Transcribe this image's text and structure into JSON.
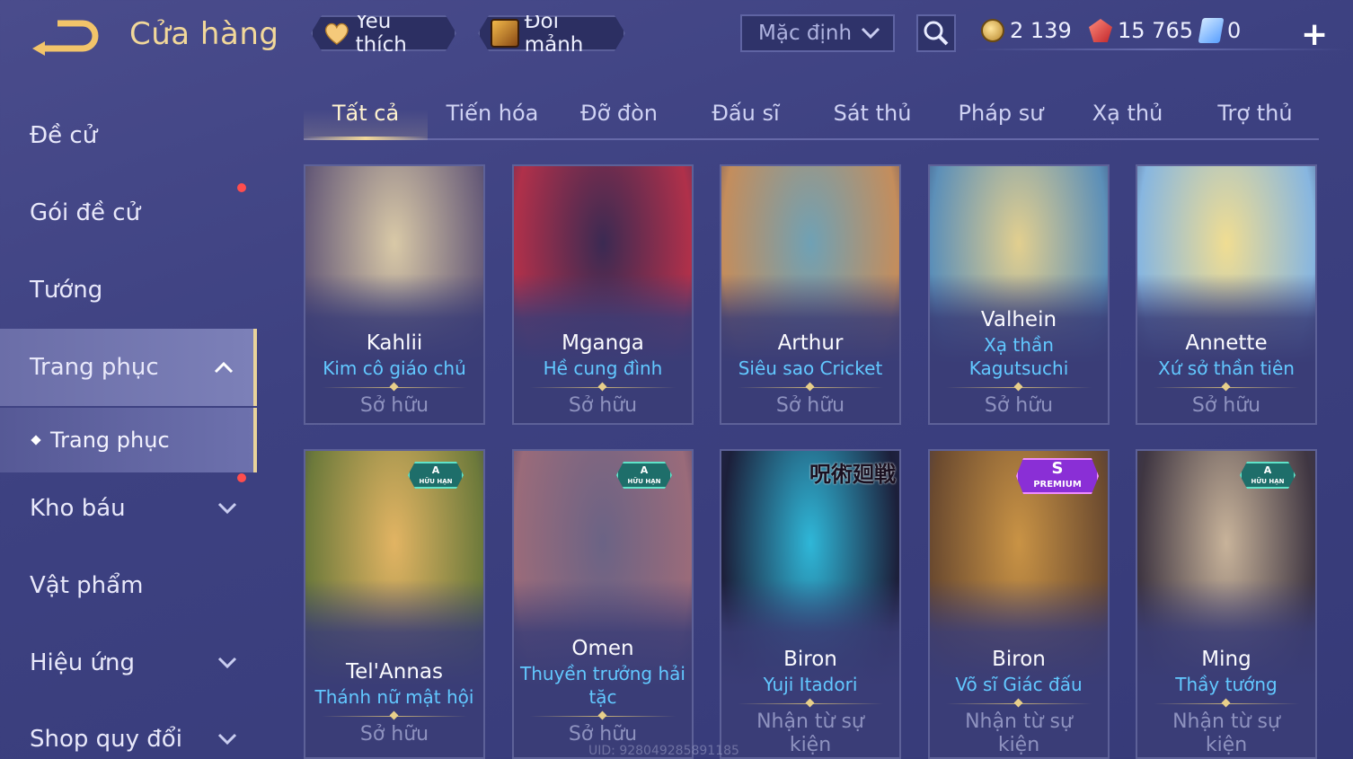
{
  "header": {
    "title": "Cửa hàng",
    "favorites_label": "Yêu thích",
    "exchange_label": "Đổi mảnh",
    "sort_value": "Mặc định",
    "currencies": [
      {
        "icon": "gold-coin-icon",
        "value": "2 139"
      },
      {
        "icon": "ruby-icon",
        "value": "15 765"
      },
      {
        "icon": "voucher-icon",
        "value": "0"
      }
    ]
  },
  "sidebar": {
    "items": [
      {
        "label": "Đề cử"
      },
      {
        "label": "Gói đề cử"
      },
      {
        "label": "Tướng"
      },
      {
        "label": "Trang phục"
      },
      {
        "label": "Kho báu"
      },
      {
        "label": "Vật phẩm"
      },
      {
        "label": "Hiệu ứng"
      },
      {
        "label": "Shop quy đổi"
      }
    ],
    "sub_item": "Trang phục"
  },
  "tabs": [
    "Tất cả",
    "Tiến hóa",
    "Đỡ đòn",
    "Đấu sĩ",
    "Sát thủ",
    "Pháp sư",
    "Xạ thủ",
    "Trợ thủ"
  ],
  "cards": [
    {
      "hero": "Kahlii",
      "skin": "Kim cô giáo chủ",
      "status": "Sở hữu",
      "badge": "",
      "colors": [
        "#d9c9a7",
        "#6b5f7a"
      ]
    },
    {
      "hero": "Mganga",
      "skin": "Hề cung đình",
      "status": "Sở hữu",
      "badge": "",
      "colors": [
        "#3b2a52",
        "#b0304a"
      ]
    },
    {
      "hero": "Arthur",
      "skin": "Siêu sao Cricket",
      "status": "Sở hữu",
      "badge": "",
      "colors": [
        "#6fa1b5",
        "#c48d5c"
      ]
    },
    {
      "hero": "Valhein",
      "skin": "Xạ thần Kagutsuchi",
      "status": "Sở hữu",
      "badge": "",
      "colors": [
        "#e2cf8f",
        "#5c8fb8"
      ]
    },
    {
      "hero": "Annette",
      "skin": "Xứ sở thần tiên",
      "status": "Sở hữu",
      "badge": "",
      "colors": [
        "#f0dd92",
        "#87b6e0"
      ]
    },
    {
      "hero": "Tel'Annas",
      "skin": "Thánh nữ mật hội",
      "status": "Sở hữu",
      "badge": "A",
      "badge_sub": "HỮU HẠN",
      "colors": [
        "#e2b463",
        "#6d7a3b"
      ]
    },
    {
      "hero": "Omen",
      "skin": "Thuyền trưởng hải tặc",
      "status": "Sở hữu",
      "badge": "A",
      "badge_sub": "HỮU HẠN",
      "colors": [
        "#6b6385",
        "#9a6b7a"
      ]
    },
    {
      "hero": "Biron",
      "skin": "Yuji Itadori",
      "status": "Nhận từ sự kiện",
      "badge": "",
      "banner": "呪術廻戦",
      "colors": [
        "#2fb7d8",
        "#1c1f3a"
      ]
    },
    {
      "hero": "Biron",
      "skin": "Võ sĩ Giác đấu",
      "status": "Nhận từ sự kiện",
      "badge": "S",
      "badge_sub": "PREMIUM",
      "colors": [
        "#c99345",
        "#6b4a2f"
      ]
    },
    {
      "hero": "Ming",
      "skin": "Thầy tướng",
      "status": "Nhận từ sự kiện",
      "badge": "A",
      "badge_sub": "HỮU HẠN",
      "colors": [
        "#c8b39a",
        "#3f3642"
      ]
    }
  ],
  "uid_text": "UID: 928049285891185",
  "colors": {
    "accent_gold": "#f2d89a",
    "skin_name": "#62c8ff",
    "notification": "#ff4d4d"
  }
}
